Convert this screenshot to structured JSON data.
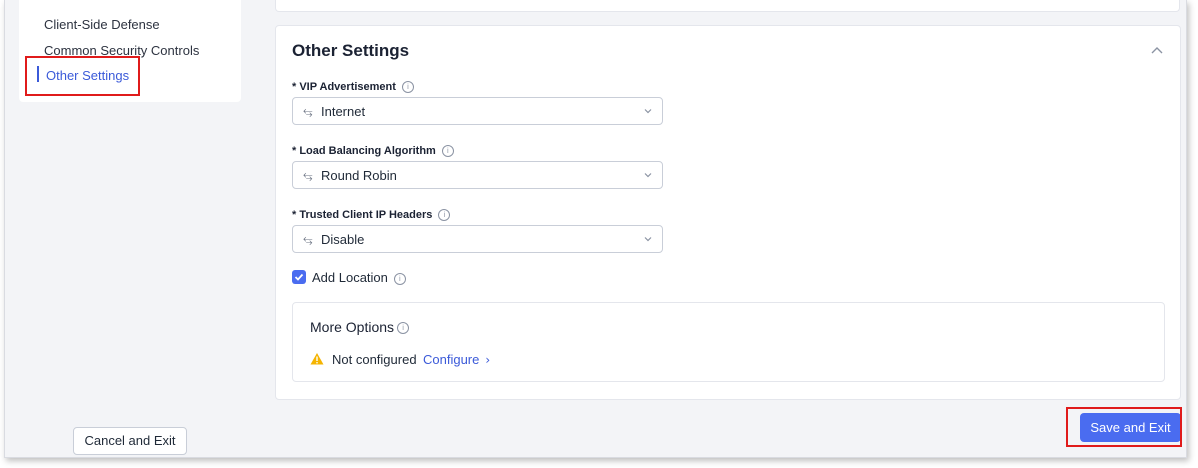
{
  "sidebar": {
    "items": [
      {
        "label": "Client-Side Defense",
        "active": false
      },
      {
        "label": "Common Security Controls",
        "active": false
      },
      {
        "label": "Other Settings",
        "active": true
      }
    ]
  },
  "section": {
    "title": "Other Settings",
    "fields": [
      {
        "label": "* VIP Advertisement",
        "value": "Internet"
      },
      {
        "label": "* Load Balancing Algorithm",
        "value": "Round Robin"
      },
      {
        "label": "* Trusted Client IP Headers",
        "value": "Disable"
      }
    ],
    "add_location": {
      "label": "Add Location",
      "checked": true
    },
    "more_options": {
      "title": "More Options",
      "status": "Not configured",
      "configure_label": "Configure"
    }
  },
  "footer": {
    "cancel_label": "Cancel and Exit",
    "save_label": "Save and Exit"
  },
  "colors": {
    "accent": "#4a6cf0",
    "link": "#3b5ad9",
    "highlight_box": "#e01b1b",
    "warning": "#f5b400"
  }
}
